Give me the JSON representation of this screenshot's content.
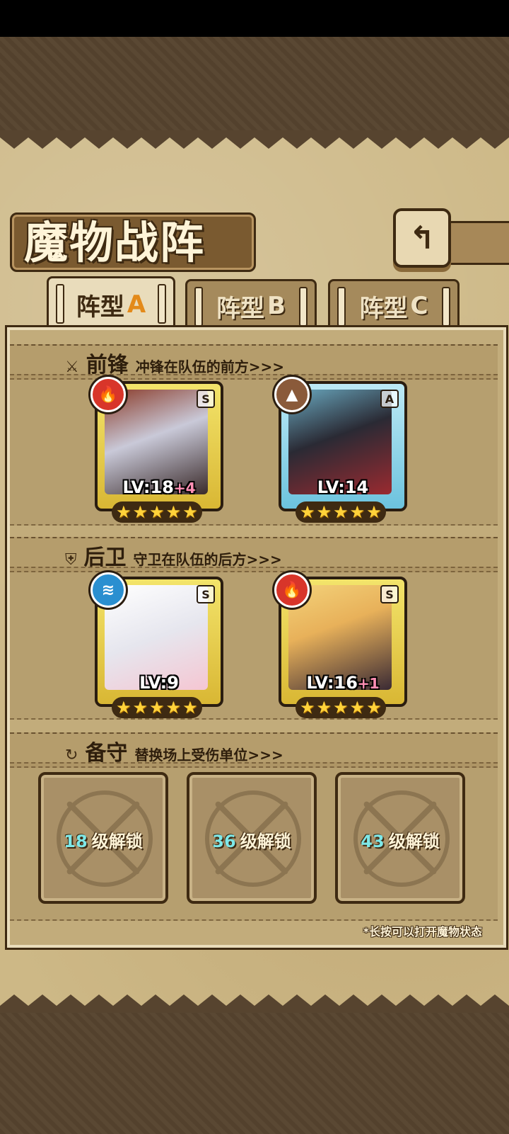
{
  "header": {
    "title": "魔物战阵",
    "back_icon": "back-arrow-icon"
  },
  "tabs": [
    {
      "label": "阵型",
      "letter": "A",
      "active": true
    },
    {
      "label": "阵型",
      "letter": "B",
      "active": false
    },
    {
      "label": "阵型",
      "letter": "C",
      "active": false
    }
  ],
  "sections": {
    "front": {
      "name": "前锋",
      "desc": "冲锋在队伍的前方>>>",
      "icon": "sword-icon"
    },
    "back": {
      "name": "后卫",
      "desc": "守卫在队伍的后方>>>",
      "icon": "shield-icon"
    },
    "reserve": {
      "name": "备守",
      "desc": "替换场上受伤单位>>>",
      "icon": "swap-icon"
    }
  },
  "units": [
    {
      "element": "fire",
      "grade": "S",
      "level_text": "LV:18",
      "bonus": "+4",
      "stars": 5,
      "accent": "#d8352a"
    },
    {
      "element": "earth",
      "grade": "A",
      "level_text": "LV:14",
      "bonus": "",
      "stars": 5,
      "accent": "#8a5a3a"
    },
    {
      "element": "water",
      "grade": "S",
      "level_text": "LV:9",
      "bonus": "",
      "stars": 5,
      "accent": "#2a8fd0"
    },
    {
      "element": "fire",
      "grade": "S",
      "level_text": "LV:16",
      "bonus": "+1",
      "stars": 5,
      "accent": "#d8352a"
    }
  ],
  "reserve_slots": [
    {
      "level": "18",
      "label": "级解锁"
    },
    {
      "level": "36",
      "label": "级解锁"
    },
    {
      "level": "43",
      "label": "级解锁"
    }
  ],
  "footer_tip": "*长按可以打开魔物状态"
}
